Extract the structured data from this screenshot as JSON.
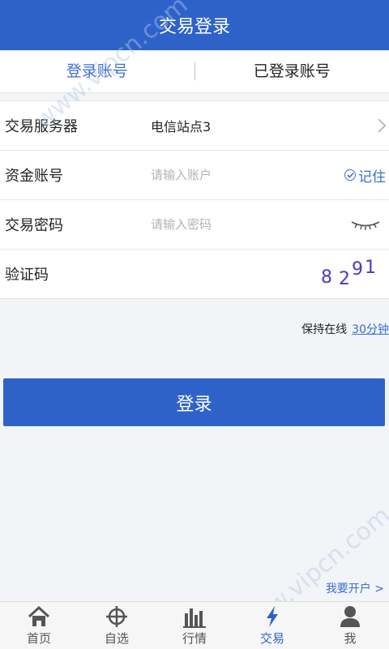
{
  "header": {
    "title": "交易登录"
  },
  "tabs": [
    {
      "label": "登录账号"
    },
    {
      "label": "已登录账号"
    }
  ],
  "form": {
    "server": {
      "label": "交易服务器",
      "value": "电信站点3"
    },
    "account": {
      "label": "资金账号",
      "placeholder": "请输入账户",
      "remember_label": "记住"
    },
    "password": {
      "label": "交易密码",
      "placeholder": "请输入密码"
    },
    "captcha": {
      "label": "验证码",
      "digits": [
        "8",
        "2",
        "9",
        "1"
      ]
    }
  },
  "keep_online": {
    "label": "保持在线",
    "value": "30分钟"
  },
  "login_button": {
    "label": "登录"
  },
  "open_account": {
    "label": "我要开户 >"
  },
  "watermark": {
    "text": "www.vipcn.com"
  },
  "tabbar": [
    {
      "label": "首页",
      "icon": "home-icon"
    },
    {
      "label": "自选",
      "icon": "crosshair-icon"
    },
    {
      "label": "行情",
      "icon": "bar-chart-icon"
    },
    {
      "label": "交易",
      "icon": "lightning-icon"
    },
    {
      "label": "我",
      "icon": "person-icon"
    }
  ],
  "colors": {
    "brand": "#2f62c9",
    "accent": "#3a6fd4",
    "captcha": "#4b3bbf"
  }
}
